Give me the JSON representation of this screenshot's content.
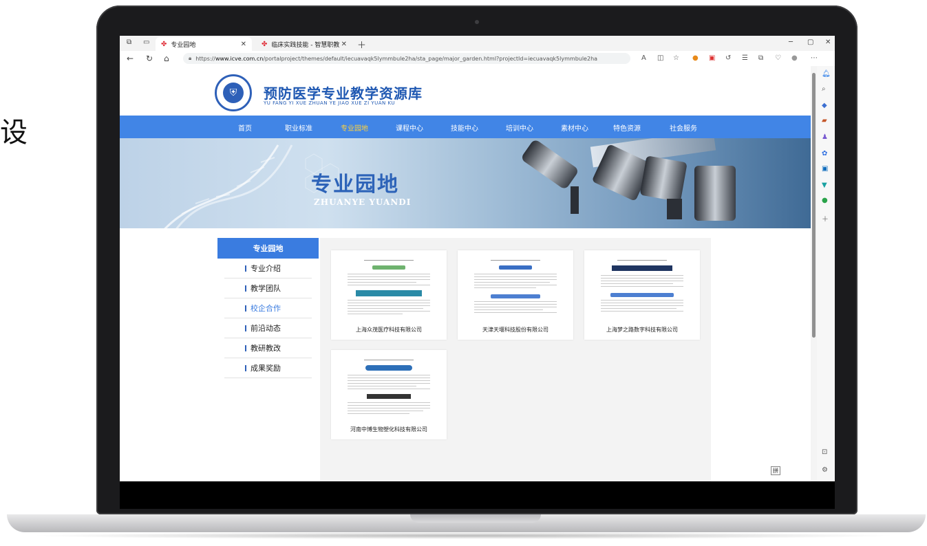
{
  "left_char": "设",
  "browser": {
    "tabs": [
      {
        "label": "专业园地",
        "active": true
      },
      {
        "label": "临床实践技能 - 智慧职教",
        "active": false
      }
    ],
    "url_prefix": "https://",
    "url_domain": "www.icve.com.cn",
    "url_path": "/portalproject/themes/default/iecuavaqk5lymmbule2ha/sta_page/major_garden.html?projectId=iecuavaqk5lymmbule2ha"
  },
  "site": {
    "title": "预防医学专业教学资源库",
    "subtitle": "YU FANG YI XUE ZHUAN YE JIAO XUE ZI YUAN KU"
  },
  "nav": [
    {
      "label": "首页",
      "active": false
    },
    {
      "label": "职业标准",
      "active": false
    },
    {
      "label": "专业园地",
      "active": true
    },
    {
      "label": "课程中心",
      "active": false
    },
    {
      "label": "技能中心",
      "active": false
    },
    {
      "label": "培训中心",
      "active": false
    },
    {
      "label": "素材中心",
      "active": false
    },
    {
      "label": "特色资源",
      "active": false
    },
    {
      "label": "社会服务",
      "active": false
    }
  ],
  "banner": {
    "title": "专业园地",
    "subtitle": "ZHUANYE YUANDI"
  },
  "sidebar": {
    "heading": "专业园地",
    "items": [
      {
        "label": "专业介绍",
        "active": false
      },
      {
        "label": "教学团队",
        "active": false
      },
      {
        "label": "校企合作",
        "active": true
      },
      {
        "label": "前沿动态",
        "active": false
      },
      {
        "label": "教研教改",
        "active": false
      },
      {
        "label": "成果奖励",
        "active": false
      }
    ]
  },
  "cards": [
    {
      "label": "上海众茂医疗科技有限公司"
    },
    {
      "label": "天津天堰科技股份有限公司"
    },
    {
      "label": "上海梦之路数字科技有限公司"
    },
    {
      "label": "河南中博生物塑化科技有限公司"
    }
  ],
  "ime_indicator": "拼"
}
